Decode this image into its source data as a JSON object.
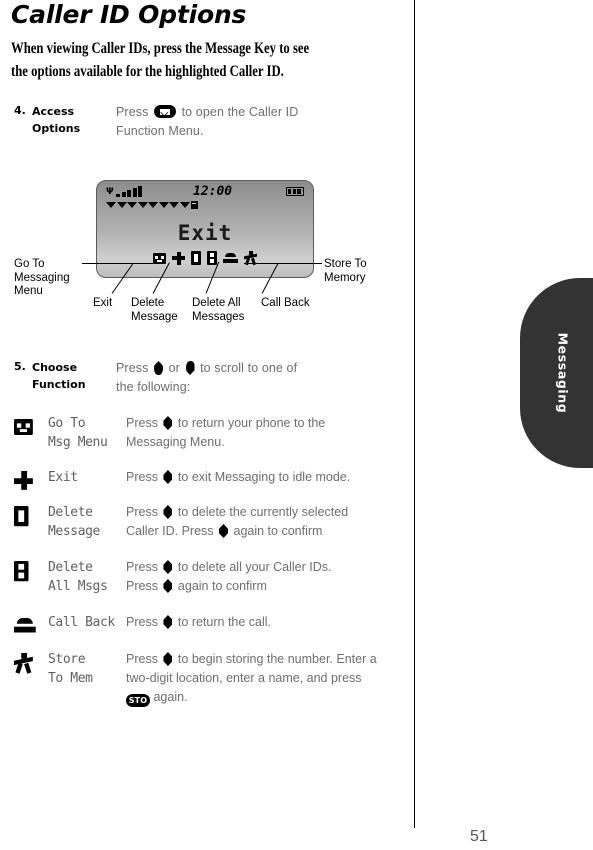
{
  "page": {
    "title": "Caller ID Options",
    "intro": "When viewing Caller IDs, press the Message Key to see the options available for the highlighted Caller ID.",
    "number": "51",
    "side_tab": "Messaging"
  },
  "steps": [
    {
      "num": "4.",
      "name_line1": "Access",
      "name_line2": "Options",
      "body_pre": "Press",
      "body_mid": "to open the Caller ID",
      "body_post": "Function Menu.",
      "icon": "envelope-key-icon"
    },
    {
      "num": "5.",
      "name_line1": "Choose",
      "name_line2": "Function",
      "body_pre": "Press",
      "body_or": "or",
      "body_mid": "to scroll to one of",
      "body_post": "the following:",
      "icon_up": "up-key-icon",
      "icon_down": "down-key-icon"
    }
  ],
  "lcd": {
    "clock": "12:00",
    "word": "Exit",
    "signal_bars": 5,
    "battery_segments": 3,
    "triangles": 8,
    "icons": [
      "msgmenu-icon",
      "exit-icon",
      "delete-message-icon",
      "delete-all-icon",
      "callback-icon",
      "store-memory-icon"
    ]
  },
  "callouts": {
    "left": "Go To\nMessaging\nMenu",
    "left_l1": "Go To",
    "left_l2": "Messaging",
    "left_l3": "Menu",
    "right_l1": "Store To",
    "right_l2": "Memory",
    "b1": "Exit",
    "b2_l1": "Delete",
    "b2_l2": "Message",
    "b3_l1": "Delete All",
    "b3_l2": "Messages",
    "b4": "Call Back"
  },
  "functions": [
    {
      "icon": "msgmenu-icon",
      "label_l1": "Go To",
      "label_l2": "Msg Menu",
      "desc_pre": "Press",
      "desc_mid": "to return your phone to the",
      "desc_post": "Messaging Menu."
    },
    {
      "icon": "exit-icon",
      "label_l1": "Exit",
      "label_l2": "",
      "desc_pre": "Press",
      "desc_mid": "to exit Messaging to idle mode.",
      "desc_post": ""
    },
    {
      "icon": "delete-message-icon",
      "label_l1": "Delete",
      "label_l2": "Message",
      "desc_pre": "Press",
      "desc_mid": "to delete the currently selected",
      "desc_post2_pre": "Caller ID. Press",
      "desc_post2_post": "again to confirm"
    },
    {
      "icon": "delete-all-icon",
      "label_l1": "Delete",
      "label_l2": "All Msgs",
      "desc_pre": "Press",
      "desc_mid": "to delete all your Caller IDs.",
      "desc_post2_pre": "Press",
      "desc_post2_post": "again to confirm"
    },
    {
      "icon": "callback-icon",
      "label_l1": "Call Back",
      "label_l2": "",
      "desc_pre": "Press",
      "desc_mid": "to return the call.",
      "desc_post": ""
    },
    {
      "icon": "store-memory-icon",
      "label_l1": "Store",
      "label_l2": "To Mem",
      "desc_pre": "Press",
      "desc_mid": "to begin storing the number. Enter a",
      "desc_line2": "two-digit location, enter a name, and press",
      "desc_line3_post": "again."
    }
  ],
  "colors": {
    "text_gray": "#6e6e6e",
    "tab_bg": "#333333",
    "black": "#000000"
  }
}
